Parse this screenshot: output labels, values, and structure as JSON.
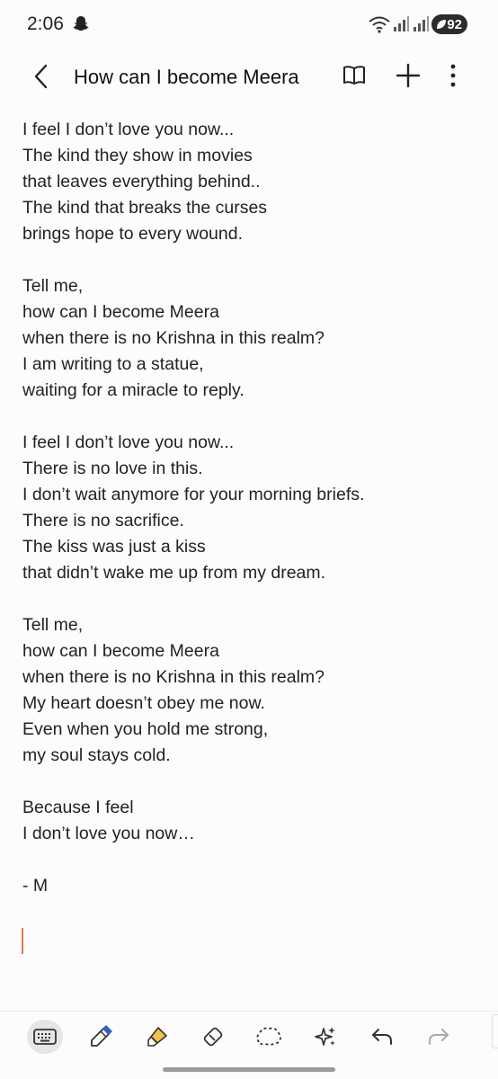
{
  "status_bar": {
    "time": "2:06",
    "battery": "92"
  },
  "header": {
    "title": "How can I become Meera"
  },
  "note": {
    "lines": [
      "I feel I don’t love you now...",
      "The kind they show in movies",
      "that leaves everything behind..",
      "The kind that breaks the curses",
      "brings hope to every wound.",
      "",
      "Tell me,",
      "how can I become Meera",
      "when there is no Krishna in this realm?",
      "I am writing to a statue,",
      "waiting for a miracle to reply.",
      "",
      "I feel I don’t love you now...",
      "There is no love in this.",
      "I don’t wait anymore for your morning briefs.",
      "There is no sacrifice.",
      "The kiss was just a kiss",
      "that didn’t wake me up from my dream.",
      "",
      "Tell me,",
      "how can I become Meera",
      "when there is no Krishna in this realm?",
      "My heart doesn’t obey me now.",
      "Even when you hold me strong,",
      "my soul stays cold.",
      "",
      "Because I feel",
      "I don’t love you now…",
      "",
      "- M"
    ]
  },
  "toolbar": {
    "tools": [
      "keyboard-icon",
      "pen-icon",
      "highlighter-icon",
      "eraser-icon",
      "lasso-icon",
      "ai-sparkle-icon",
      "undo-icon",
      "redo-icon"
    ],
    "active": "keyboard-icon"
  },
  "colors": {
    "background": "#fcfcfc",
    "text": "#222222",
    "cursor": "#e07a54",
    "pen_blue": "#2f5fd0",
    "highlighter_yellow": "#f3c24a"
  }
}
